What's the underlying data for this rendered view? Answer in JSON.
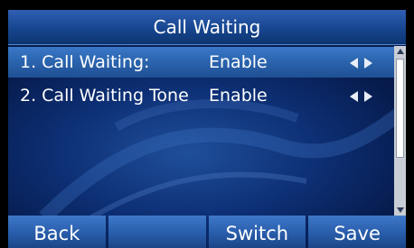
{
  "title": "Call Waiting",
  "rows": [
    {
      "label": "1. Call Waiting:",
      "value": "Enable",
      "selected": true
    },
    {
      "label": "2. Call Waiting Tone",
      "value": "Enable",
      "selected": false
    }
  ],
  "softkeys": [
    "Back",
    "",
    "Switch",
    "Save"
  ],
  "colors": {
    "background": "#0d2f74",
    "title_bar": "#17468f",
    "highlight": "#2a63ad",
    "softkey": "#2a5fad",
    "text": "#ffffff"
  },
  "icons": {
    "left_arrow": "left-triangle",
    "right_arrow": "right-triangle",
    "scroll_up": "up-triangle",
    "scroll_down": "down-triangle"
  }
}
